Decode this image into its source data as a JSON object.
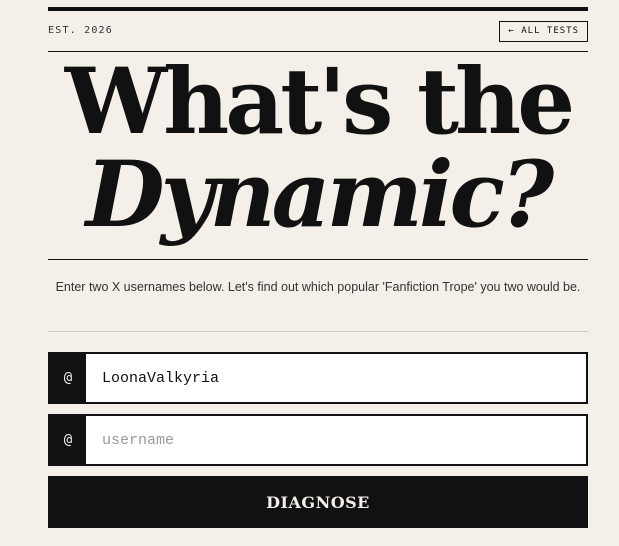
{
  "header": {
    "est_label": "EST. 2026",
    "back_link_label": "← ALL TESTS"
  },
  "title": {
    "line1": "What's the",
    "line2": "Dynamic?"
  },
  "intro": {
    "text": "Enter two X usernames below. Let's find out which popular 'Fanfiction Trope' you two would be."
  },
  "form": {
    "prefix_symbol": "@",
    "username_1": {
      "value": "LoonaValkyria",
      "placeholder": "username"
    },
    "username_2": {
      "value": "",
      "placeholder": "username"
    },
    "submit_label": "DIAGNOSE"
  },
  "colors": {
    "background": "#f4efe8",
    "ink": "#111111",
    "button_text": "#f4efe8"
  }
}
